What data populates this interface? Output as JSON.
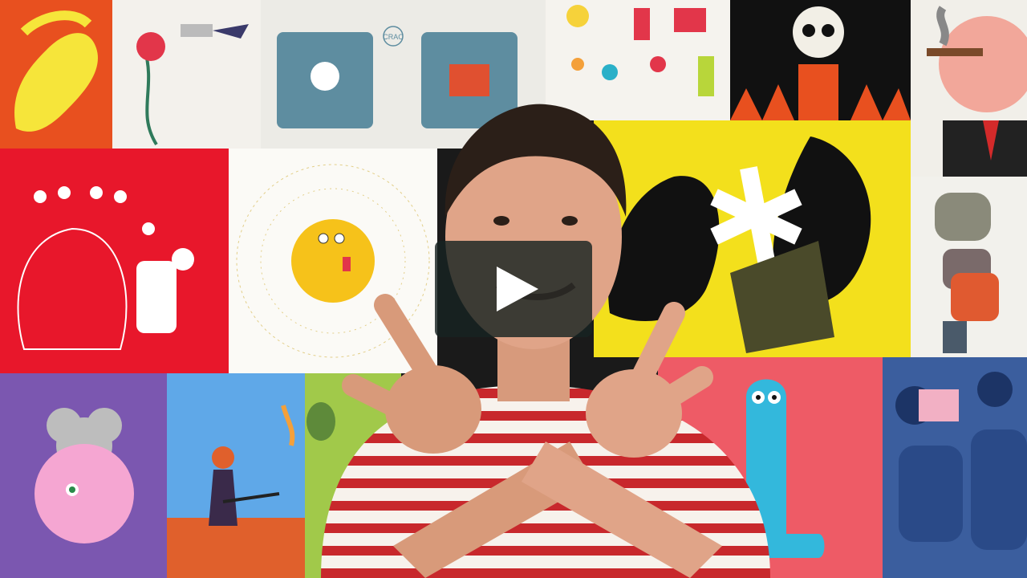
{
  "video": {
    "play_button_label": "Play",
    "play_icon": "play-icon",
    "colors": {
      "play_button_bg": "#172322",
      "play_icon": "#ffffff",
      "shirt_stripe": "#c8282c"
    }
  },
  "illustrations": {
    "crac_text": "CRAC"
  }
}
